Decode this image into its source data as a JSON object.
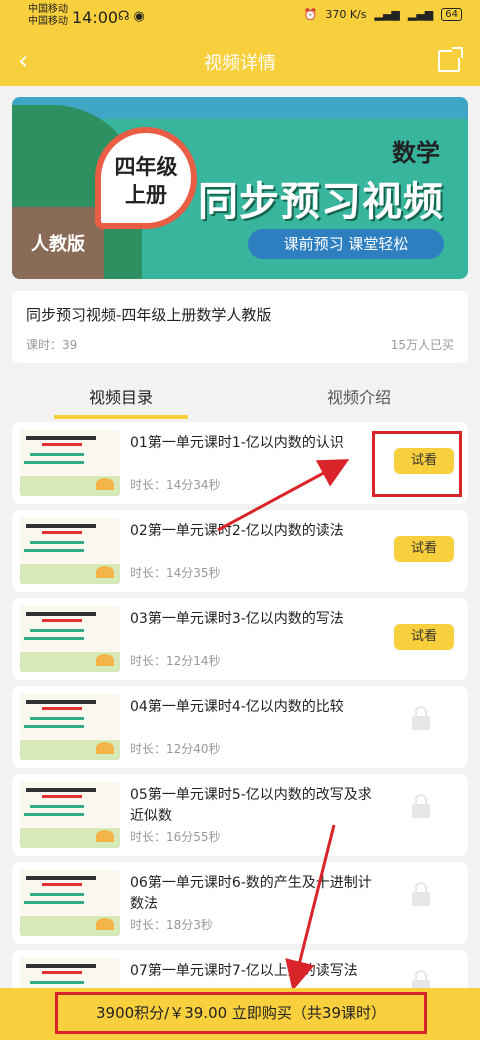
{
  "statusbar": {
    "carrier1": "中国移动",
    "carrier2": "中国移动",
    "time": "14:00",
    "net_speed": "370 K/s",
    "battery": "64"
  },
  "navbar": {
    "title": "视频详情",
    "back_icon": "chevron-left-icon",
    "share_icon": "share-icon"
  },
  "banner": {
    "grade_line1": "四年级",
    "grade_line2": "上册",
    "subject": "数学",
    "headline": "同步预习视频",
    "slogan": "课前预习 课堂轻松",
    "edition": "人教版"
  },
  "course": {
    "title": "同步预习视频-四年级上册数学人教版",
    "lessons": "课时：39",
    "learners": "15万人已买"
  },
  "tabs": {
    "catalog": "视频目录",
    "intro": "视频介绍"
  },
  "items": [
    {
      "name": "01第一单元课时1-亿以内数的认识",
      "duration": "时长：14分34秒",
      "action": "试看"
    },
    {
      "name": "02第一单元课时2-亿以内数的读法",
      "duration": "时长：14分35秒",
      "action": "试看"
    },
    {
      "name": "03第一单元课时3-亿以内数的写法",
      "duration": "时长：12分14秒",
      "action": "试看"
    },
    {
      "name": "04第一单元课时4-亿以内数的比较",
      "duration": "时长：12分40秒",
      "action": "lock"
    },
    {
      "name": "05第一单元课时5-亿以内数的改写及求近似数",
      "duration": "时长：16分55秒",
      "action": "lock"
    },
    {
      "name": "06第一单元课时6-数的产生及十进制计数法",
      "duration": "时长：18分3秒",
      "action": "lock"
    },
    {
      "name": "07第一单元课时7-亿以上数的读写法",
      "duration": "",
      "action": "lock"
    }
  ],
  "buy": {
    "label": "3900积分/￥39.00 立即购买（共39课时）"
  },
  "colors": {
    "accent": "#f8cf3c",
    "annotation": "#d9252a"
  }
}
